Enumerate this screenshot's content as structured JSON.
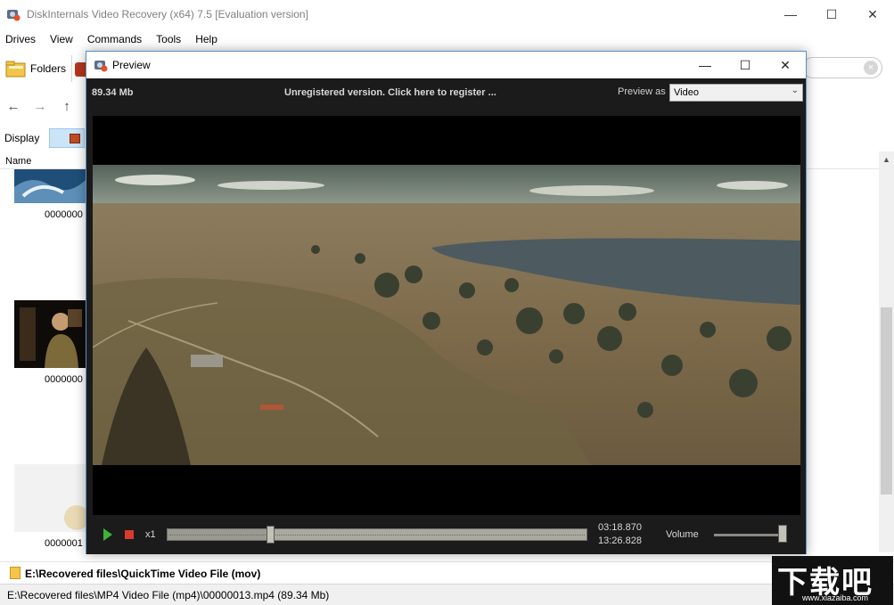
{
  "window": {
    "title": "DiskInternals Video Recovery (x64) 7.5 [Evaluation version]",
    "controls": {
      "minimize": "—",
      "maximize": "☐",
      "close": "✕"
    }
  },
  "menu": [
    "Drives",
    "View",
    "Commands",
    "Tools",
    "Help"
  ],
  "toolbar": {
    "folders_label": "Folders"
  },
  "search": {
    "value": "",
    "clear_icon": "×"
  },
  "nav": {
    "back": "←",
    "forward": "→",
    "up": "↑"
  },
  "display": {
    "label": "Display"
  },
  "list": {
    "column_name": "Name",
    "items": [
      {
        "label": "0000000"
      },
      {
        "label": "0000000"
      },
      {
        "label": "0000001"
      }
    ]
  },
  "path_bar": {
    "text": "E:\\Recovered files\\QuickTime Video File (mov)"
  },
  "status_bar": {
    "text": "E:\\Recovered files\\MP4 Video File (mp4)\\00000013.mp4 (89.34 Mb)"
  },
  "preview": {
    "title": "Preview",
    "controls": {
      "minimize": "—",
      "maximize": "☐",
      "close": "✕"
    },
    "file_size": "89.34 Mb",
    "register_text": "Unregistered version. Click here to register ...",
    "preview_as_label": "Preview as",
    "preview_as_value": "Video",
    "speed": "x1",
    "current_time": "03:18.870",
    "total_time": "13:26.828",
    "progress_fraction": 0.24,
    "volume_label": "Volume",
    "volume_fraction": 1.0
  },
  "watermark": {
    "main": "下载吧",
    "sub": "www.xiazaiba.com"
  }
}
